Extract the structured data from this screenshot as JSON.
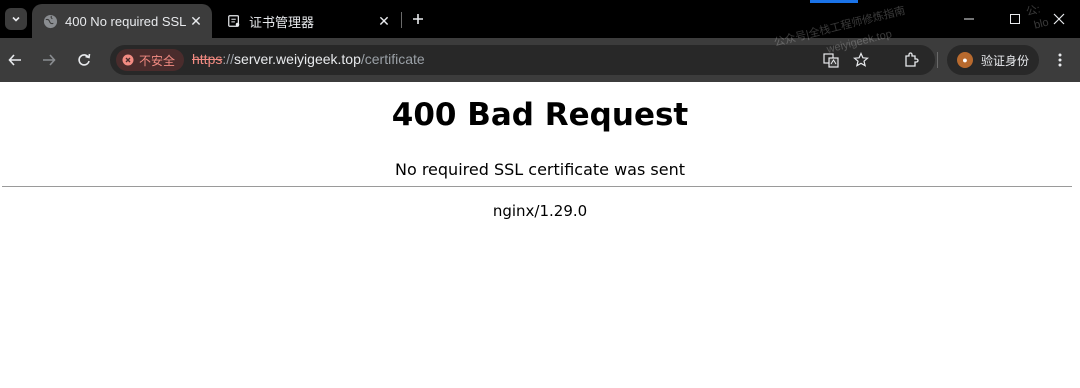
{
  "tabs": [
    {
      "title": "400 No required SSL",
      "icon": "globe-icon",
      "active": true
    },
    {
      "title": "证书管理器",
      "icon": "certificate-icon",
      "active": false
    }
  ],
  "toolbar": {
    "security_label": "不安全",
    "url_scheme": "https",
    "url_sep": "://",
    "url_host": "server.weiyigeek.top",
    "url_path": "/certificate",
    "profile_label": "验证身份"
  },
  "watermark": {
    "line1": "公众号|全栈工程师修炼指南",
    "line2": "weiyigeek.top",
    "corner1": "公:",
    "corner2": "blo"
  },
  "page": {
    "heading": "400 Bad Request",
    "message": "No required SSL certificate was sent",
    "server": "nginx/1.29.0"
  },
  "colors": {
    "tabstrip": "#000000",
    "toolbar": "#3c3c3c",
    "insecure": "#f28b82",
    "page_bg": "#ffffff"
  }
}
